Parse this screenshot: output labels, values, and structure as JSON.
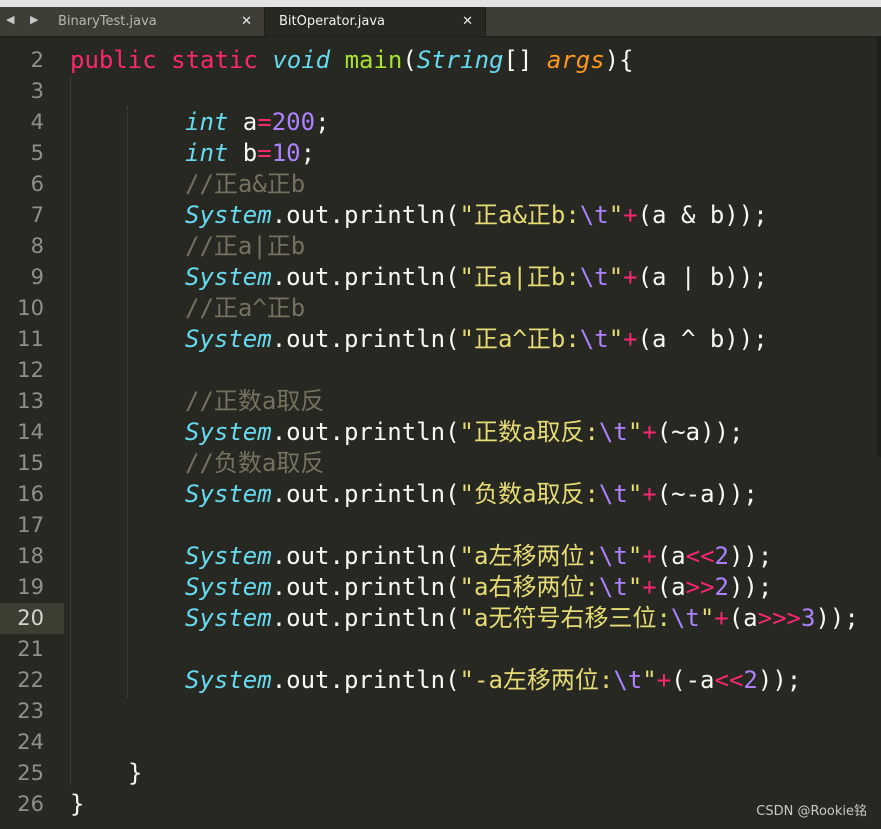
{
  "tabs": [
    {
      "label": "BinaryTest.java",
      "close": "✕",
      "active": false
    },
    {
      "label": "BitOperator.java",
      "close": "✕",
      "active": true
    }
  ],
  "nav_arrows": "◀ ▶",
  "line_numbers": [
    "2",
    "3",
    "4",
    "5",
    "6",
    "7",
    "8",
    "9",
    "10",
    "11",
    "12",
    "13",
    "14",
    "15",
    "16",
    "17",
    "18",
    "19",
    "20",
    "21",
    "22",
    "23",
    "24",
    "25",
    "26"
  ],
  "current_line": "20",
  "code": {
    "l2": {
      "t1": "public",
      "t2": "static",
      "t3": "void",
      "t4": "main",
      "t5": "(",
      "t6": "String",
      "t7": "[] ",
      "t8": "args",
      "t9": "){"
    },
    "l4": {
      "t1": "int",
      "t2": " a",
      "t3": "=",
      "t4": "200",
      "t5": ";"
    },
    "l5": {
      "t1": "int",
      "t2": " b",
      "t3": "=",
      "t4": "10",
      "t5": ";"
    },
    "l6": "//正a&正b",
    "l7": {
      "sys": "System",
      "out": ".out.",
      "p": "println(",
      "s1": "\"正a&正b:",
      "esc": "\\t",
      "s2": "\"",
      "plus": "+",
      "rest": "(a & b));"
    },
    "l8": "//正a|正b",
    "l9": {
      "sys": "System",
      "out": ".out.",
      "p": "println(",
      "s1": "\"正a|正b:",
      "esc": "\\t",
      "s2": "\"",
      "plus": "+",
      "rest": "(a | b));"
    },
    "l10": "//正a^正b",
    "l11": {
      "sys": "System",
      "out": ".out.",
      "p": "println(",
      "s1": "\"正a^正b:",
      "esc": "\\t",
      "s2": "\"",
      "plus": "+",
      "rest": "(a ^ b));"
    },
    "l13": "//正数a取反",
    "l14": {
      "sys": "System",
      "out": ".out.",
      "p": "println(",
      "s1": "\"正数a取反:",
      "esc": "\\t",
      "s2": "\"",
      "plus": "+",
      "rest": "(~a));"
    },
    "l15": "//负数a取反",
    "l16": {
      "sys": "System",
      "out": ".out.",
      "p": "println(",
      "s1": "\"负数a取反:",
      "esc": "\\t",
      "s2": "\"",
      "plus": "+",
      "rest": "(~-a));"
    },
    "l18": {
      "sys": "System",
      "out": ".out.",
      "p": "println(",
      "s1": "\"a左移两位:",
      "esc": "\\t",
      "s2": "\"",
      "plus": "+",
      "r1": "(a",
      "shift": "<<",
      "n": "2",
      "r2": "));"
    },
    "l19": {
      "sys": "System",
      "out": ".out.",
      "p": "println(",
      "s1": "\"a右移两位:",
      "esc": "\\t",
      "s2": "\"",
      "plus": "+",
      "r1": "(a",
      "shift": ">>",
      "n": "2",
      "r2": "));"
    },
    "l20": {
      "sys": "System",
      "out": ".out.",
      "p": "println(",
      "s1": "\"a无符号右移三位:",
      "esc": "\\t",
      "s2": "\"",
      "plus": "+",
      "r1": "(a",
      "shift": ">>>",
      "n": "3",
      "r2": "));"
    },
    "l22": {
      "sys": "System",
      "out": ".out.",
      "p": "println(",
      "s1": "\"-a左移两位:",
      "esc": "\\t",
      "s2": "\"",
      "plus": "+",
      "r1": "(-a",
      "shift": "<<",
      "n": "2",
      "r2": "));"
    },
    "l25": "}",
    "l26": "}"
  },
  "watermark": "CSDN @Rookie铭",
  "colors": {
    "background": "#272822",
    "keyword": "#f92672",
    "type": "#66d9ef",
    "function": "#a6e22e",
    "parameter": "#fd971f",
    "number": "#ae81ff",
    "string": "#e6db74",
    "comment": "#75715e"
  }
}
